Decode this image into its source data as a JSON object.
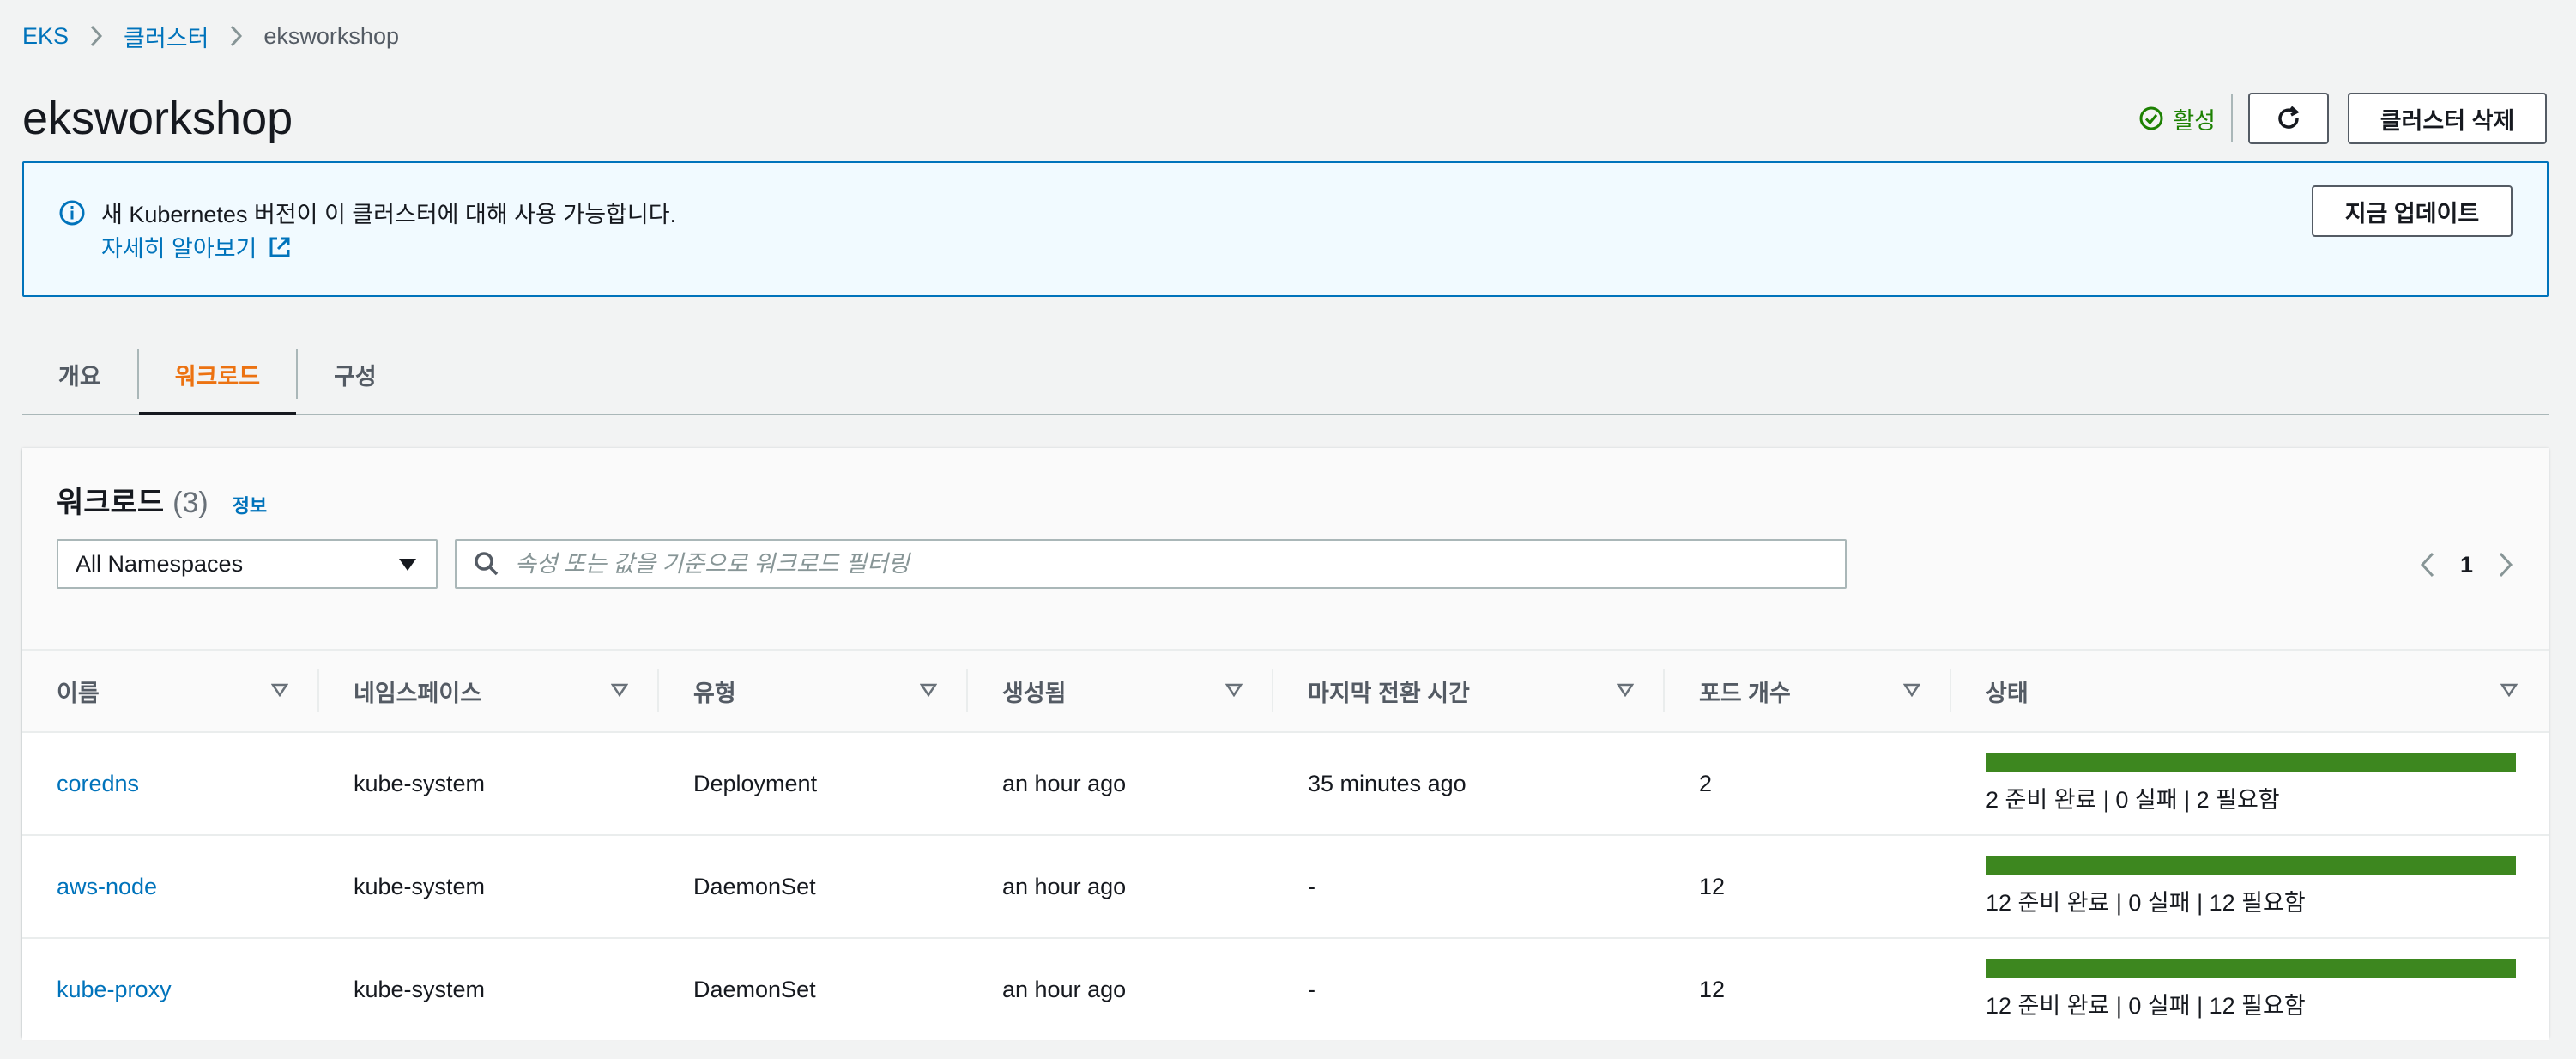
{
  "breadcrumb": {
    "items": [
      "EKS",
      "클러스터"
    ],
    "current": "eksworkshop"
  },
  "page": {
    "title": "eksworkshop",
    "status": "활성",
    "delete_label": "클러스터 삭제"
  },
  "banner": {
    "message": "새 Kubernetes 버전이 이 클러스터에 대해 사용 가능합니다.",
    "learn_more": "자세히 알아보기",
    "update_label": "지금 업데이트"
  },
  "tabs": [
    {
      "label": "개요",
      "active": false
    },
    {
      "label": "워크로드",
      "active": true
    },
    {
      "label": "구성",
      "active": false
    }
  ],
  "workloads": {
    "title": "워크로드",
    "count": "(3)",
    "info": "정보",
    "namespace_selected": "All Namespaces",
    "search_placeholder": "속성 또는 값을 기준으로 워크로드 필터링",
    "page": "1",
    "columns": [
      "이름",
      "네임스페이스",
      "유형",
      "생성됨",
      "마지막 전환 시간",
      "포드 개수",
      "상태"
    ],
    "rows": [
      {
        "name": "coredns",
        "namespace": "kube-system",
        "type": "Deployment",
        "created": "an hour ago",
        "last_transition": "35 minutes ago",
        "pods": "2",
        "status": "2 준비 완료 | 0 실패 | 2 필요함",
        "ready_fraction": 1.0
      },
      {
        "name": "aws-node",
        "namespace": "kube-system",
        "type": "DaemonSet",
        "created": "an hour ago",
        "last_transition": "-",
        "pods": "12",
        "status": "12 준비 완료 | 0 실패 | 12 필요함",
        "ready_fraction": 1.0
      },
      {
        "name": "kube-proxy",
        "namespace": "kube-system",
        "type": "DaemonSet",
        "created": "an hour ago",
        "last_transition": "-",
        "pods": "12",
        "status": "12 준비 완료 | 0 실패 | 12 필요함",
        "ready_fraction": 1.0
      }
    ]
  },
  "colors": {
    "link": "#0073bb",
    "active_tab": "#ec7211",
    "success": "#1d8102",
    "progress": "#3d871f"
  }
}
